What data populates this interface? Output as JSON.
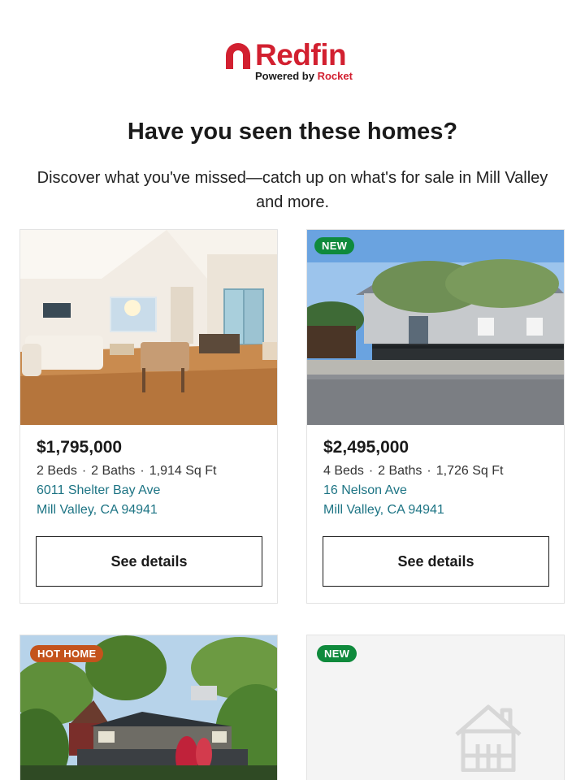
{
  "brand": {
    "name": "Redfin",
    "powered_prefix": "Powered by",
    "powered_brand": "Rocket",
    "color": "#d22030"
  },
  "headline": "Have you seen these homes?",
  "subhead": "Discover what you've missed—catch up on what's for sale in Mill Valley and more.",
  "listings": [
    {
      "price": "$1,795,000",
      "beds": "2 Beds",
      "baths": "2 Baths",
      "sqft": "1,914 Sq Ft",
      "address_line1": "6011 Shelter Bay Ave",
      "address_line2": "Mill Valley, CA 94941",
      "button_label": "See details",
      "photo": "living-room-interior"
    },
    {
      "badge": "NEW",
      "price": "$2,495,000",
      "beds": "4 Beds",
      "baths": "2 Baths",
      "sqft": "1,726 Sq Ft",
      "address_line1": "16 Nelson Ave",
      "address_line2": "Mill Valley, CA 94941",
      "button_label": "See details",
      "photo": "house-exterior-street"
    },
    {
      "badge": "HOT HOME",
      "photo": "hillside-house-trees"
    },
    {
      "badge": "NEW",
      "photo": "house-placeholder-icon"
    }
  ],
  "colors": {
    "link": "#1d7484",
    "badge_new": "#0f8a3c",
    "badge_hot": "#c4531c"
  }
}
